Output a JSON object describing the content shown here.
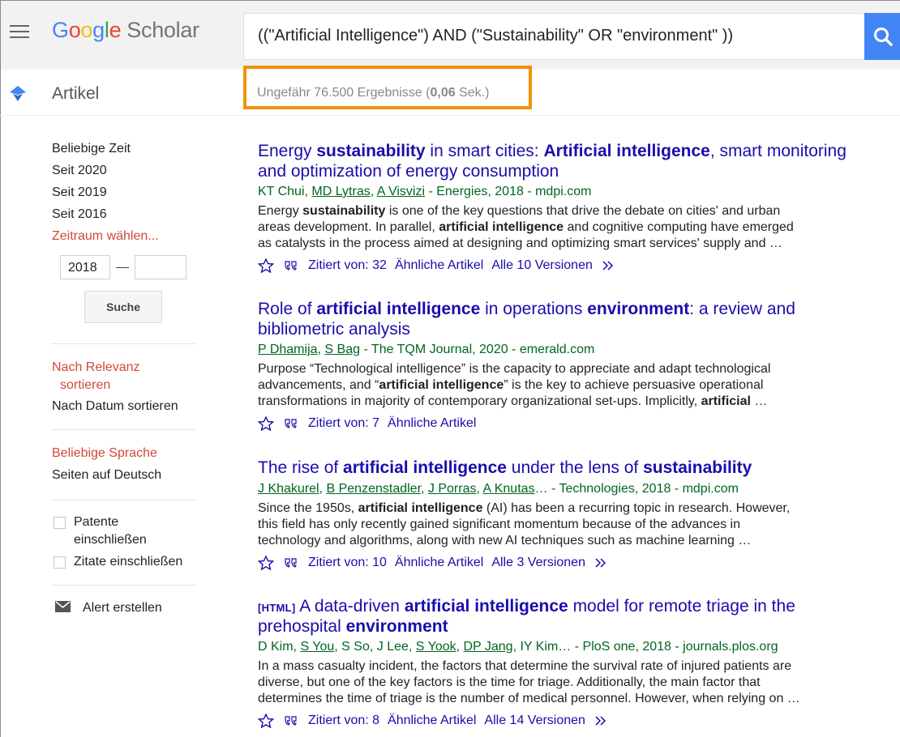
{
  "header": {
    "logo_google": [
      "G",
      "o",
      "o",
      "g",
      "l",
      "e"
    ],
    "logo_scholar": "Scholar",
    "search_query": "((\"Artificial Intelligence\") AND (\"Sustainability\" OR \"environment\" ))"
  },
  "subheader": {
    "section": "Artikel",
    "result_count_prefix": "Ungefähr 76.500 Ergebnisse (",
    "result_time": "0,06",
    "result_count_suffix": " Sek.)"
  },
  "sidebar": {
    "time": [
      "Beliebige Zeit",
      "Seit 2020",
      "Seit 2019",
      "Seit 2016"
    ],
    "custom_range": "Zeitraum wählen...",
    "year_from": "2018",
    "year_to": "",
    "search_button": "Suche",
    "sort_relevance_1": "Nach Relevanz",
    "sort_relevance_2": "sortieren",
    "sort_date": "Nach Datum sortieren",
    "lang_any": "Beliebige Sprache",
    "lang_german": "Seiten auf Deutsch",
    "patents_1": "Patente",
    "patents_2": "einschließen",
    "citations": "Zitate einschließen",
    "alert": "Alert erstellen"
  },
  "results": [
    {
      "title_parts": [
        "Energy ",
        "sustainability",
        " in smart cities: ",
        "Artificial intelligence",
        ", smart monitoring"
      ],
      "title_line2": "and optimization of energy consumption",
      "authors_parts": [
        "KT Chui, ",
        "MD Lytras",
        ", ",
        "A Visvizi",
        " - Energies, 2018 - mdpi.com"
      ],
      "snippet": [
        [
          "Energy ",
          "sustainability",
          " is one of the key questions that drive the debate on cities' and urban"
        ],
        [
          "areas development. In parallel, ",
          "artificial intelligence",
          " and cognitive computing have emerged"
        ],
        [
          "as catalysts in the process aimed at designing and optimizing smart services' supply and …"
        ]
      ],
      "cited": "Zitiert von: 32",
      "related": "Ähnliche Artikel",
      "versions": "Alle 10 Versionen"
    },
    {
      "title_parts": [
        "Role of ",
        "artificial intelligence",
        " in operations ",
        "environment",
        ": a review and"
      ],
      "title_line2": "bibliometric analysis",
      "authors_parts": [
        "P Dhamija",
        ", ",
        "S Bag",
        " - The TQM Journal, 2020 - emerald.com"
      ],
      "snippet": [
        [
          "Purpose “Technological intelligence” is the capacity to appreciate and adapt technological"
        ],
        [
          "advancements, and “",
          "artificial intelligence",
          "” is the key to achieve persuasive operational"
        ],
        [
          "transformations in majority of contemporary organizational set-ups. Implicitly, ",
          "artificial",
          " …"
        ]
      ],
      "cited": "Zitiert von: 7",
      "related": "Ähnliche Artikel"
    },
    {
      "title_parts": [
        "The rise of ",
        "artificial intelligence",
        " under the lens of ",
        "sustainability"
      ],
      "authors_parts": [
        "J Khakurel",
        ", ",
        "B Penzenstadler",
        ", ",
        "J Porras",
        ", ",
        "A Knutas",
        "… - Technologies, 2018 - mdpi.com"
      ],
      "snippet": [
        [
          "Since the 1950s, ",
          "artificial intelligence",
          " (AI) has been a recurring topic in research. However,"
        ],
        [
          "this field has only recently gained significant momentum because of the advances in"
        ],
        [
          "technology and algorithms, along with new AI techniques such as machine learning …"
        ]
      ],
      "cited": "Zitiert von: 10",
      "related": "Ähnliche Artikel",
      "versions": "Alle 3 Versionen"
    },
    {
      "html_tag": "[HTML]",
      "title_parts": [
        " A data-driven ",
        "artificial intelligence",
        " model for remote triage in the"
      ],
      "title_line2_parts": [
        "prehospital ",
        "environment"
      ],
      "authors_parts": [
        "D Kim, ",
        "S You",
        ", S So, J Lee, ",
        "S Yook",
        ", ",
        "DP Jang",
        ", IY Kim… - PloS one, 2018 - journals.plos.org"
      ],
      "snippet": [
        [
          "In a mass casualty incident, the factors that determine the survival rate of injured patients are"
        ],
        [
          "diverse, but one of the key factors is the time for triage. Additionally, the main factor that"
        ],
        [
          "determines the time of triage is the number of medical personnel. However, when relying on …"
        ]
      ],
      "cited": "Zitiert von: 8",
      "related": "Ähnliche Artikel",
      "versions": "Alle 14 Versionen"
    }
  ]
}
